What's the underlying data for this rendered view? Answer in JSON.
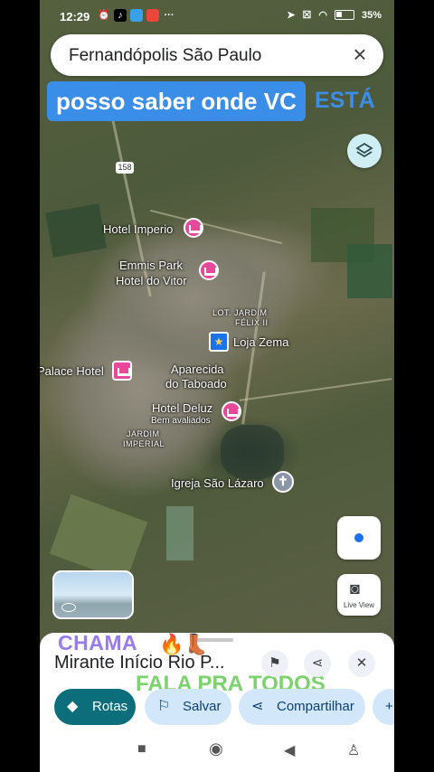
{
  "status_bar": {
    "time": "12:29",
    "battery": "35"
  },
  "search": {
    "query": "Fernandópolis São Paulo"
  },
  "overlay": {
    "caption": "posso saber onde VC",
    "caption_tail": "ESTÁ"
  },
  "map": {
    "route_shield": "158",
    "labels": {
      "hotel_imperio": "Hotel Imperio",
      "emmis_park_1": "Emmis Park",
      "emmis_park_2": "Hotel do Vitor",
      "lot_jardim_1": "LOT. JARDIM",
      "lot_jardim_2": "FÉLIX II",
      "loja_zema": "Loja Zema",
      "palace_hotel": "Palace Hotel",
      "aparecida_1": "Aparecida",
      "aparecida_2": "do Taboado",
      "hotel_deluz": "Hotel Deluz",
      "hotel_deluz_sub": "Bem avaliados",
      "jardim_imperial_1": "JARDIM",
      "jardim_imperial_2": "IMPERIAL",
      "igreja": "Igreja São Lázaro"
    }
  },
  "controls": {
    "live_view": "Live View"
  },
  "sheet": {
    "overlay_top": "CHAMA",
    "title": "Mirante Início Rio P...",
    "overlay_bottom": "FALA PRA TODOS",
    "actions": {
      "rotas": "Rotas",
      "salvar": "Salvar",
      "compartilhar": "Compartilhar"
    }
  },
  "colors": {
    "accent": "#0b6e7a",
    "chip_bg": "#d3e7fb",
    "caption_bg": "#3b8ee8"
  }
}
